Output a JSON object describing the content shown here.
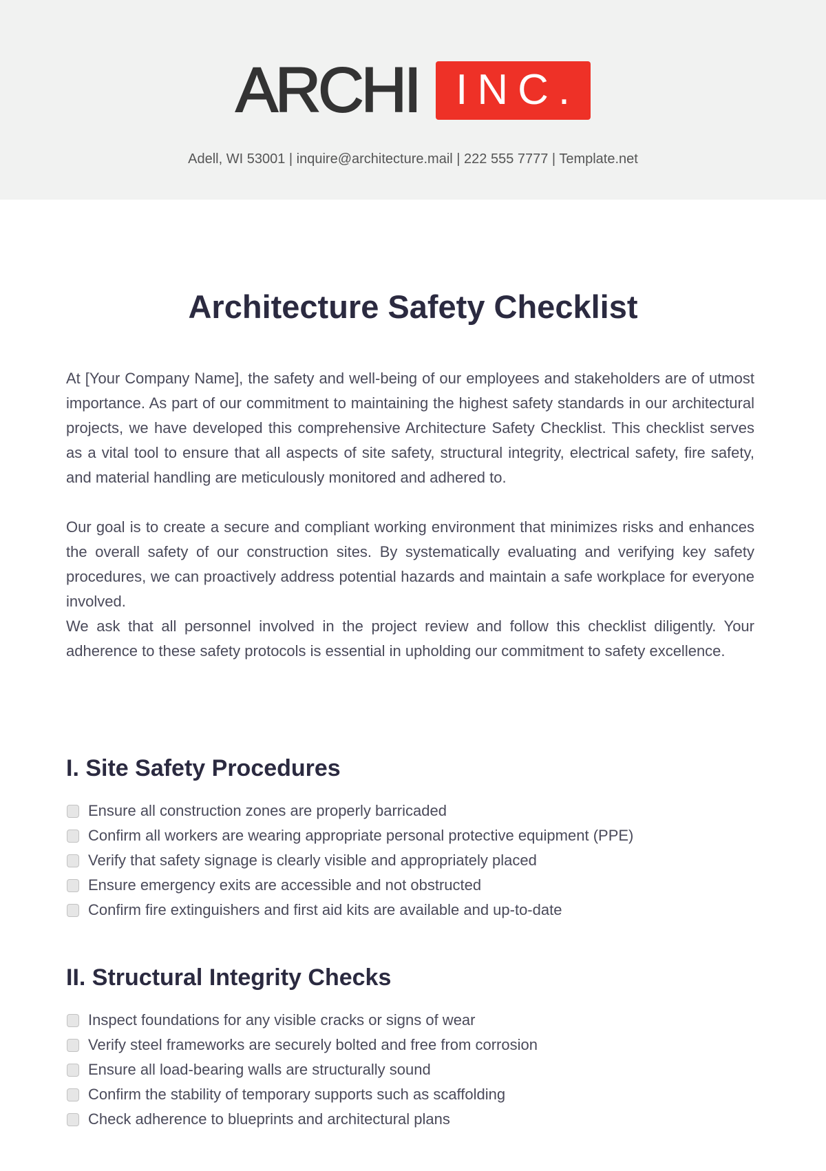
{
  "header": {
    "logo": {
      "wordmark": "ARCHI",
      "badge": "INC.",
      "badge_color": "#ee3127",
      "wordmark_color": "#333333"
    },
    "contact_line": "Adell, WI 53001 | inquire@architecture.mail | 222 555 7777 | Template.net"
  },
  "document": {
    "title": "Architecture Safety Checklist",
    "paragraphs": [
      "At [Your Company Name], the safety and well-being of our employees and stakeholders are of utmost importance. As part of our commitment to maintaining the highest safety standards in our architectural projects, we have developed this comprehensive Architecture Safety Checklist. This checklist serves as a vital tool to ensure that all aspects of site safety, structural integrity, electrical safety, fire safety, and material handling are meticulously monitored and adhered to.",
      "Our goal is to create a secure and compliant working environment that minimizes risks and enhances the overall safety of our construction sites. By systematically evaluating and verifying key safety procedures, we can proactively address potential hazards and maintain a safe workplace for everyone involved.",
      "We ask that all personnel involved in the project review and follow this checklist diligently. Your adherence to these safety protocols is essential in upholding our commitment to safety excellence."
    ],
    "sections": [
      {
        "heading": "I. Site Safety Procedures",
        "items": [
          {
            "label": "Ensure all construction zones are properly barricaded",
            "checked": false
          },
          {
            "label": "Confirm all workers are wearing appropriate personal protective equipment (PPE)",
            "checked": false
          },
          {
            "label": "Verify that safety signage is clearly visible and appropriately placed",
            "checked": false
          },
          {
            "label": "Ensure emergency exits are accessible and not obstructed",
            "checked": false
          },
          {
            "label": "Confirm fire extinguishers and first aid kits are available and up-to-date",
            "checked": false
          }
        ]
      },
      {
        "heading": "II. Structural Integrity Checks",
        "items": [
          {
            "label": "Inspect foundations for any visible cracks or signs of wear",
            "checked": false
          },
          {
            "label": "Verify steel frameworks are securely bolted and free from corrosion",
            "checked": false
          },
          {
            "label": "Ensure all load-bearing walls are structurally sound",
            "checked": false
          },
          {
            "label": "Confirm the stability of temporary supports such as scaffolding",
            "checked": false
          },
          {
            "label": "Check adherence to blueprints and architectural plans",
            "checked": false
          }
        ]
      }
    ]
  },
  "colors": {
    "header_background": "#f1f2f1",
    "heading_text": "#2b2a40",
    "body_text": "#4a4a5a"
  }
}
